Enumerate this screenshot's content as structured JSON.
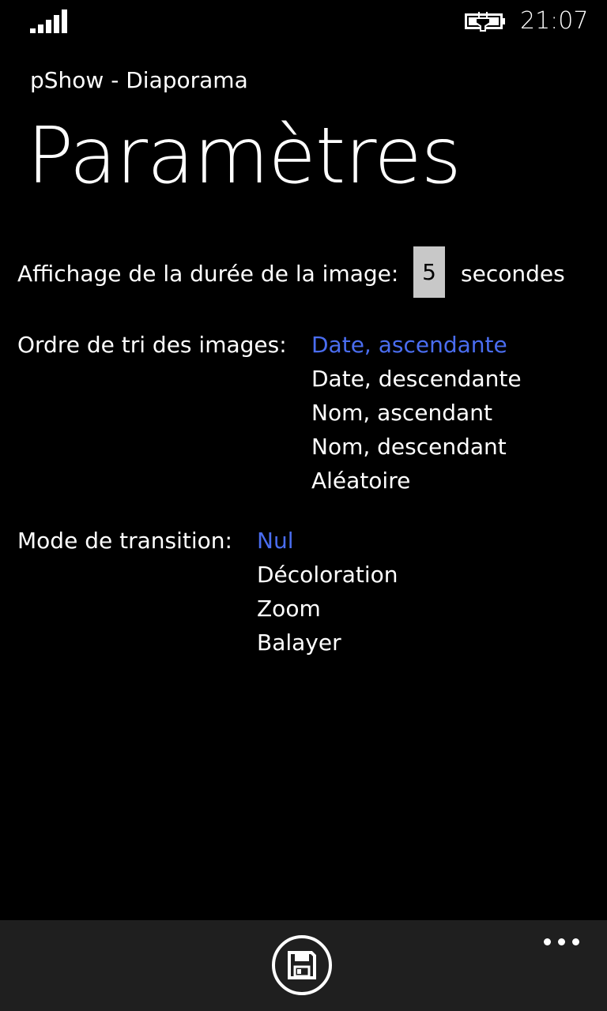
{
  "status_bar": {
    "time": "21:07",
    "signal_icon": "signal-strength-icon",
    "battery_icon": "battery-charging-icon"
  },
  "header": {
    "app_title": "pShow - Diaporama",
    "page_title": "Paramètres"
  },
  "settings": {
    "duration": {
      "label": "Affichage de la durée de la image:",
      "value": "5",
      "unit": "secondes"
    },
    "sort_order": {
      "label": "Ordre de tri des images:",
      "options": [
        {
          "label": "Date, ascendante",
          "selected": true
        },
        {
          "label": "Date, descendante",
          "selected": false
        },
        {
          "label": "Nom, ascendant",
          "selected": false
        },
        {
          "label": "Nom, descendant",
          "selected": false
        },
        {
          "label": "Aléatoire",
          "selected": false
        }
      ]
    },
    "transition_mode": {
      "label": "Mode de transition:",
      "options": [
        {
          "label": "Nul",
          "selected": true
        },
        {
          "label": "Décoloration",
          "selected": false
        },
        {
          "label": "Zoom",
          "selected": false
        },
        {
          "label": "Balayer",
          "selected": false
        }
      ]
    }
  },
  "app_bar": {
    "save_icon": "save-icon",
    "more_icon": "more-icon"
  },
  "colors": {
    "background": "#000000",
    "accent": "#4a6df0",
    "app_bar": "#1f1f1f",
    "input_bg": "#c8c8c8"
  }
}
